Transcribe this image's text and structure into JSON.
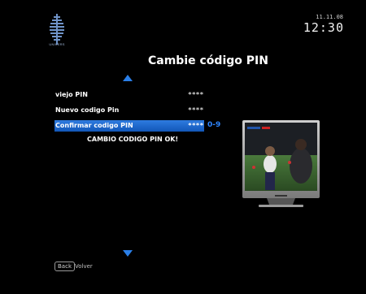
{
  "header": {
    "date": "11.11.08",
    "time": "12:30",
    "brand": "UNIVERS",
    "title": "Cambie código PIN"
  },
  "menu": {
    "items": [
      {
        "label": "viejo PIN",
        "value": "****",
        "selected": false
      },
      {
        "label": "Nuevo codigo Pin",
        "value": "****",
        "selected": false
      },
      {
        "label": "Confirmar codigo PIN",
        "value": "****",
        "selected": true
      }
    ],
    "hint": "0-9",
    "status": "CAMBIO CODIGO PIN OK!"
  },
  "footer": {
    "back_key": "Back",
    "back_label": "Volver"
  },
  "colors": {
    "accent": "#2a7fe8",
    "selection": "#1e6bd0",
    "background": "#000000"
  },
  "icons": {
    "up": "arrow-up-icon",
    "down": "arrow-down-icon",
    "logo": "brand-logo-icon",
    "tv": "tv-preview-icon"
  }
}
